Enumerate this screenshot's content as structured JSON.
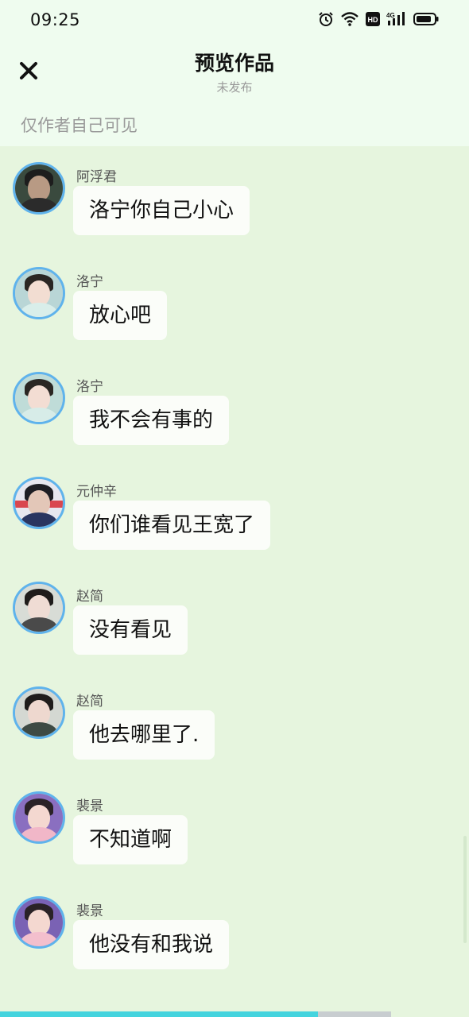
{
  "status_bar": {
    "time": "09:25",
    "icons": [
      "alarm-icon",
      "wifi-icon",
      "hd-icon",
      "4g-signal-icon",
      "battery-icon"
    ]
  },
  "header": {
    "close_icon": "close-icon",
    "title": "预览作品",
    "subtitle": "未发布"
  },
  "visibility_note": "仅作者自己可见",
  "messages": [
    {
      "name": "阿浮君",
      "text": "洛宁你自己小心",
      "avatar": "avatar-afujun"
    },
    {
      "name": "洛宁",
      "text": "放心吧",
      "avatar": "avatar-luoning"
    },
    {
      "name": "洛宁",
      "text": "我不会有事的",
      "avatar": "avatar-luoning"
    },
    {
      "name": "元仲辛",
      "text": "你们谁看见王宽了",
      "avatar": "avatar-yuanzhongxin"
    },
    {
      "name": "赵简",
      "text": "没有看见",
      "avatar": "avatar-zhaojian"
    },
    {
      "name": "赵简",
      "text": "他去哪里了.",
      "avatar": "avatar-zhaojian"
    },
    {
      "name": "裴景",
      "text": "不知道啊",
      "avatar": "avatar-peijing"
    },
    {
      "name": "裴景",
      "text": "他没有和我说",
      "avatar": "avatar-peijing"
    }
  ],
  "colors": {
    "background": "#e6f5de",
    "header_background": "#effcef",
    "bubble": "#fbfdf9",
    "avatar_border": "#5fb3ec",
    "progress": "#44d4de"
  }
}
